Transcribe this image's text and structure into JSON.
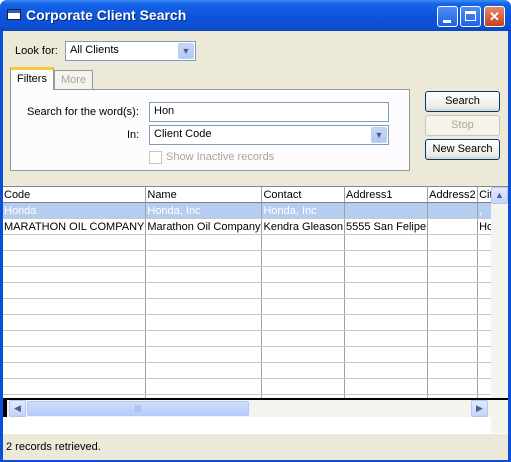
{
  "window": {
    "title": "Corporate Client Search"
  },
  "search": {
    "look_for_label": "Look for:",
    "look_for_value": "All Clients",
    "tabs": [
      {
        "label": "Filters",
        "active": true
      },
      {
        "label": "More",
        "active": false
      }
    ],
    "words_label": "Search for the word(s):",
    "words_value": "Hon",
    "in_label": "In:",
    "in_value": "Client Code",
    "inactive_label": "Show Inactive records",
    "inactive_checked": false
  },
  "buttons": {
    "search": "Search",
    "stop": "Stop",
    "new_search": "New Search"
  },
  "grid": {
    "columns": [
      "Code",
      "Name",
      "Contact",
      "Address1",
      "Address2",
      "City,"
    ],
    "rows": [
      [
        "Honda",
        "Honda, Inc",
        "Honda, Inc",
        "",
        "",
        ","
      ],
      [
        "MARATHON OIL COMPANY",
        "Marathon Oil Company",
        "Kendra Gleason",
        "5555 San Felipe",
        "",
        "Hous"
      ]
    ],
    "selected_row": 0,
    "empty_rows": 11
  },
  "status": {
    "text": "2 records retrieved."
  }
}
